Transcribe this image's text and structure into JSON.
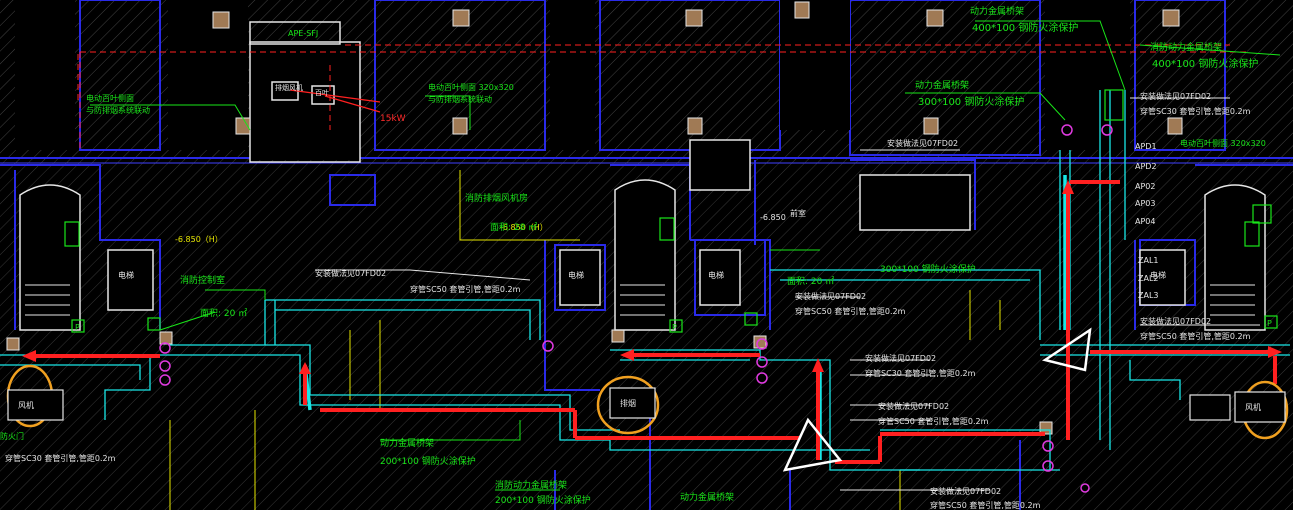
{
  "colors": {
    "background": "#000000",
    "wall": "#2a2ae8",
    "hatch": "#8a8a8a",
    "tray": "#19e6e6",
    "route_arrow": "#ff2020",
    "highlight_circle": "#f0a020",
    "annotation_green": "#19e619",
    "annotation_white": "#e6e6e6",
    "annotation_yellow": "#e6e600",
    "room_outline": "#e6e6e6",
    "column_fill": "#a07a55"
  },
  "labels": {
    "power_tray_top": "动力金属桥架",
    "tray_size_top": "400*100 钢防火涂保护",
    "fire_tray_right": "消防动力金属桥架",
    "fire_tray_size_right": "400*100 钢防火涂保护",
    "power_tray_mid": "动力金属桥架",
    "tray_size_mid": "300*100 钢防火涂保护",
    "ape_box": "APE-SFJ",
    "power_15kw": "15kW",
    "note_grille": "电动百叶侧面 320x320",
    "note_grille2": "电动百叶侧面 320x320",
    "note_grille3": "与防排烟系统联动",
    "note_left1": "电动百叶侧面",
    "note_left2": "与防排烟系统联动",
    "note_install_1": "安装做法见07FD02",
    "note_install_2": "穿管SC50 套管引管,管距0.2m",
    "note_install_3": "安装做法见07FD02",
    "note_install_4": "穿管SC50 套管引管,管距0.2m",
    "note_install_5": "安装做法见07FD02",
    "note_install_6": "穿管SC50 套管引管,管距0.2m",
    "note_install_7": "安装做法见07FD02",
    "note_install_8": "穿管SC30 套管引管,管距0.2m",
    "note_install_9": "安装做法见07FD02",
    "note_install_10": "穿管SC50 套管引管,管距0.2m",
    "note_install_11": "安装做法见07FD02",
    "note_install_12": "穿管SC50 套管引管,管距0.2m",
    "note_install_13": "安装做法见07FD02",
    "note_install_14": "穿管SC50 套管引管,管距0.2m",
    "note_install_15": "安装做法见07FD02",
    "note_install_16": "穿管SC50 套管引管,管距0.2m",
    "note_install_17": "穿管SC30 套管引管,管距0.2m",
    "elev_1": "-6.850（H）",
    "elev_2": "-6.850（H）",
    "elev_3": "-6.850",
    "elev_4": "-6.850（H）",
    "fire_room": "消防排烟风机房",
    "fire_room_2": "消防控制室",
    "area_1": "面积: 28 ㎡",
    "area_2": "面积: 20 ㎡",
    "area_3": "面积: 20 ㎡",
    "power_tray_bottom": "动力金属桥架",
    "tray_size_bottom": "200*100 钢防火涂保护",
    "fire_tray_bottom": "消防动力金属桥架",
    "fire_tray_size_bottom": "200*100 钢防火涂保护",
    "power_tray_bottom2": "动力金属桥架",
    "tray_size_right_mid": "300*100 钢防火涂保护",
    "ap_1": "APD1",
    "ap_2": "APD2",
    "ap_3": "AP02",
    "ap_4": "AP03",
    "ap_5": "AP04",
    "al_1": "ZAL1",
    "al_2": "ZAL2",
    "al_3": "ZAL3",
    "left_bottom_1": "防火门",
    "left_bottom_2": "穿管SC30 套管引管,管距0.2m",
    "feng_ji": "风机",
    "pai_yan": "排烟",
    "dian_ti": "电梯",
    "qian_shi": "前室",
    "box_p": "P",
    "smoke_label": "排烟风机",
    "louver_label": "百叶"
  }
}
